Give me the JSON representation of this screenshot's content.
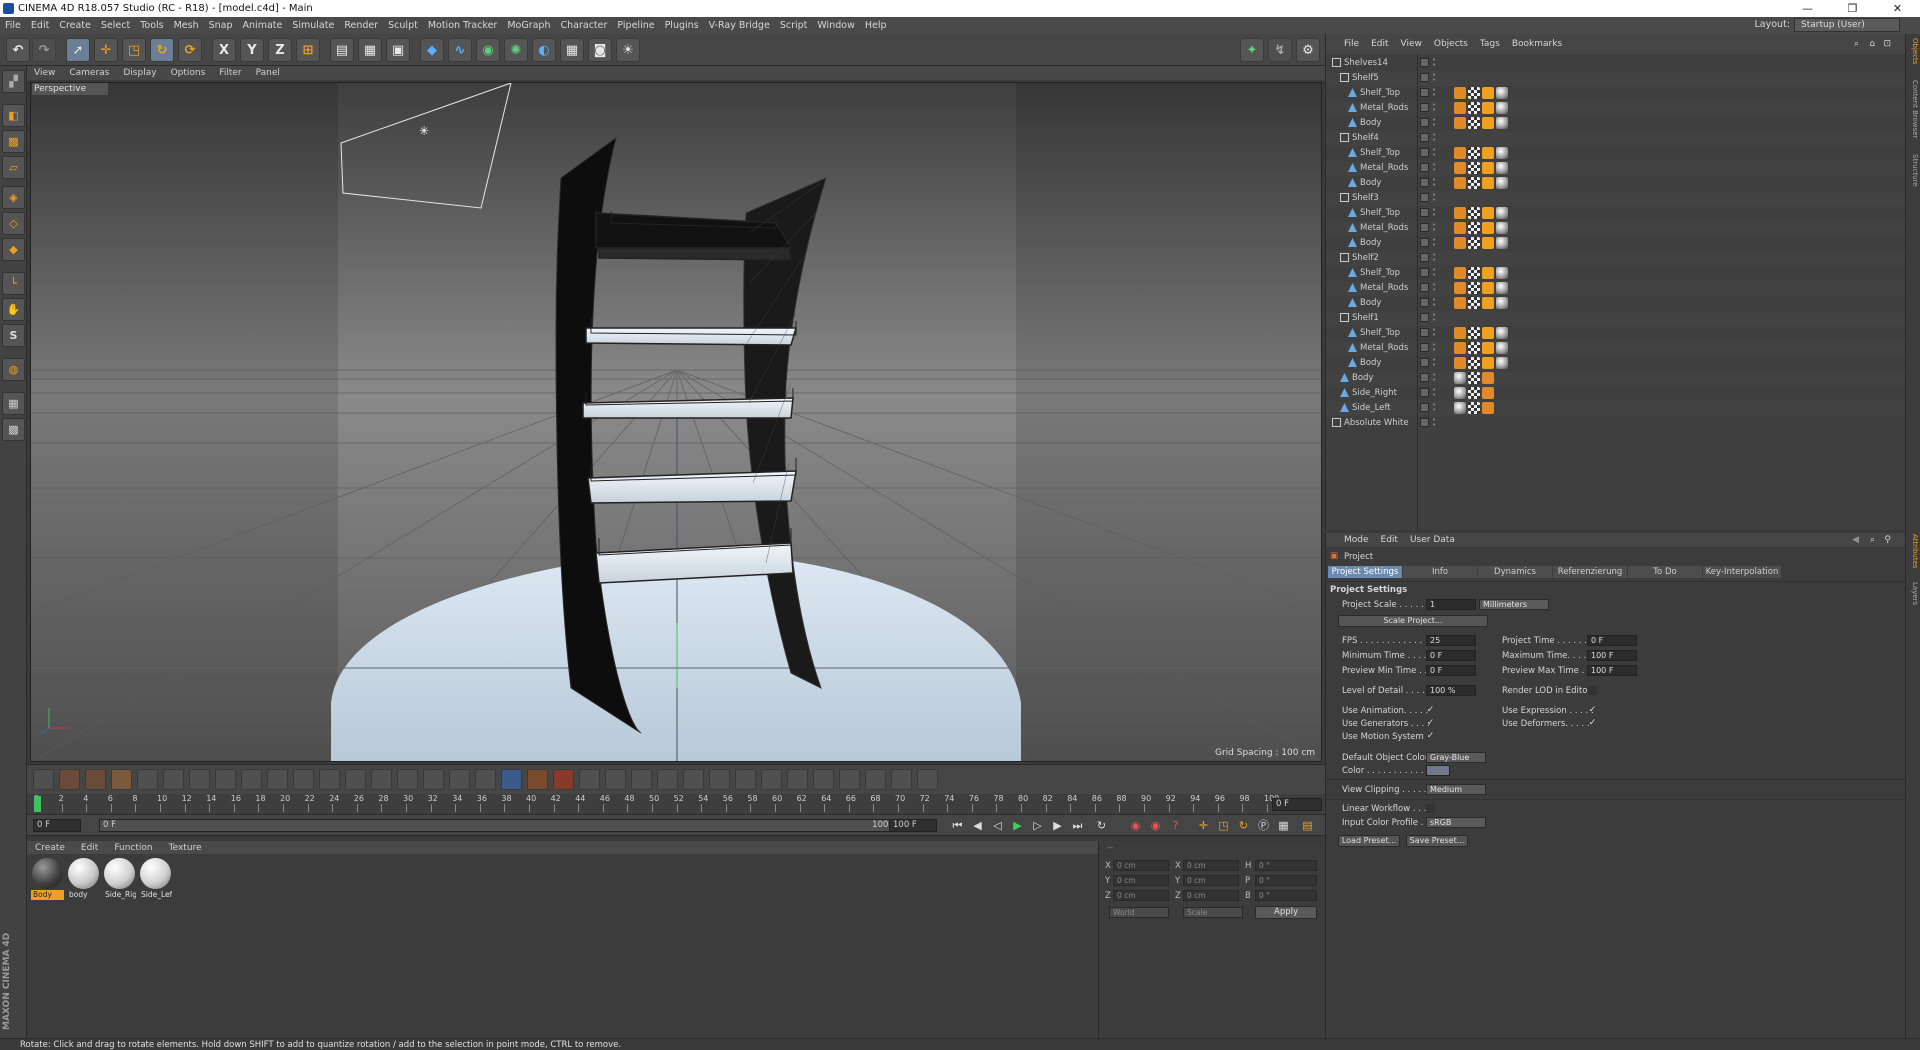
{
  "window": {
    "title": "CINEMA 4D R18.057 Studio (RC - R18) - [model.c4d] - Main",
    "controls": [
      "—",
      "❐",
      "✕"
    ]
  },
  "menubar": {
    "items": [
      "File",
      "Edit",
      "Create",
      "Select",
      "Tools",
      "Mesh",
      "Snap",
      "Animate",
      "Simulate",
      "Render",
      "Sculpt",
      "Motion Tracker",
      "MoGraph",
      "Character",
      "Pipeline",
      "Plugins",
      "V-Ray Bridge",
      "Script",
      "Window",
      "Help"
    ],
    "layout_label": "Layout:",
    "layout_value": "Startup (User)"
  },
  "toolbar": {
    "axis_x": "X",
    "axis_y": "Y",
    "axis_z": "Z"
  },
  "viewport": {
    "menu": [
      "View",
      "Cameras",
      "Display",
      "Options",
      "Filter",
      "Panel"
    ],
    "label": "Perspective",
    "grid_spacing": "Grid Spacing : 100 cm"
  },
  "timeline": {
    "ticks": [
      "0",
      "2",
      "4",
      "6",
      "8",
      "10",
      "12",
      "14",
      "16",
      "18",
      "20",
      "22",
      "24",
      "26",
      "28",
      "30",
      "32",
      "34",
      "36",
      "38",
      "40",
      "42",
      "44",
      "46",
      "48",
      "50",
      "52",
      "54",
      "56",
      "58",
      "60",
      "62",
      "64",
      "66",
      "68",
      "70",
      "72",
      "74",
      "76",
      "78",
      "80",
      "82",
      "84",
      "86",
      "88",
      "90",
      "92",
      "94",
      "96",
      "98",
      "100"
    ],
    "end_field": "0 F",
    "current": "0 F",
    "range_start": "0 F",
    "range_end": "100 F",
    "max": "100 F"
  },
  "material_manager": {
    "menu": [
      "Create",
      "Edit",
      "Function",
      "Texture"
    ],
    "materials": [
      {
        "name": "Body",
        "selected": true,
        "color": "#404040"
      },
      {
        "name": "body",
        "selected": false,
        "color": "#c9c9c9"
      },
      {
        "name": "Side_Rig",
        "selected": false,
        "color": "#d0d0d0"
      },
      {
        "name": "Side_Lef",
        "selected": false,
        "color": "#d0d0d0"
      }
    ]
  },
  "coordinates": {
    "header": "--",
    "rows": [
      {
        "a": "X",
        "av": "0 cm",
        "b": "X",
        "bv": "0 cm",
        "c": "H",
        "cv": "0 °"
      },
      {
        "a": "Y",
        "av": "0 cm",
        "b": "Y",
        "bv": "0 cm",
        "c": "P",
        "cv": "0 °"
      },
      {
        "a": "Z",
        "av": "0 cm",
        "b": "Z",
        "bv": "0 cm",
        "c": "B",
        "cv": "0 °"
      }
    ],
    "mode": "World",
    "scale_mode": "Scale",
    "apply": "Apply"
  },
  "logo": "MAXON CINEMA 4D",
  "status": "Rotate: Click and drag to rotate elements. Hold down SHIFT to add to quantize rotation / add to the selection in point mode, CTRL to remove.",
  "object_manager": {
    "menu": [
      "File",
      "Edit",
      "View",
      "Objects",
      "Tags",
      "Bookmarks"
    ],
    "rows": [
      {
        "name": "Shelves14",
        "indent": 0,
        "type": "null",
        "tags": 0
      },
      {
        "name": "Shelf5",
        "indent": 1,
        "type": "null",
        "tags": 0
      },
      {
        "name": "Shelf_Top",
        "indent": 2,
        "type": "poly",
        "tags": 4
      },
      {
        "name": "Metal_Rods",
        "indent": 2,
        "type": "poly",
        "tags": 4
      },
      {
        "name": "Body",
        "indent": 2,
        "type": "poly",
        "tags": 4
      },
      {
        "name": "Shelf4",
        "indent": 1,
        "type": "null",
        "tags": 0
      },
      {
        "name": "Shelf_Top",
        "indent": 2,
        "type": "poly",
        "tags": 4
      },
      {
        "name": "Metal_Rods",
        "indent": 2,
        "type": "poly",
        "tags": 4
      },
      {
        "name": "Body",
        "indent": 2,
        "type": "poly",
        "tags": 4
      },
      {
        "name": "Shelf3",
        "indent": 1,
        "type": "null",
        "tags": 0
      },
      {
        "name": "Shelf_Top",
        "indent": 2,
        "type": "poly",
        "tags": 4
      },
      {
        "name": "Metal_Rods",
        "indent": 2,
        "type": "poly",
        "tags": 4
      },
      {
        "name": "Body",
        "indent": 2,
        "type": "poly",
        "tags": 4
      },
      {
        "name": "Shelf2",
        "indent": 1,
        "type": "null",
        "tags": 0
      },
      {
        "name": "Shelf_Top",
        "indent": 2,
        "type": "poly",
        "tags": 4
      },
      {
        "name": "Metal_Rods",
        "indent": 2,
        "type": "poly",
        "tags": 4
      },
      {
        "name": "Body",
        "indent": 2,
        "type": "poly",
        "tags": 4
      },
      {
        "name": "Shelf1",
        "indent": 1,
        "type": "null",
        "tags": 0
      },
      {
        "name": "Shelf_Top",
        "indent": 2,
        "type": "poly",
        "tags": 4
      },
      {
        "name": "Metal_Rods",
        "indent": 2,
        "type": "poly",
        "tags": 4
      },
      {
        "name": "Body",
        "indent": 2,
        "type": "poly",
        "tags": 4
      },
      {
        "name": "Body",
        "indent": 1,
        "type": "poly",
        "tags": 3
      },
      {
        "name": "Side_Right",
        "indent": 1,
        "type": "poly",
        "tags": 3
      },
      {
        "name": "Side_Left",
        "indent": 1,
        "type": "poly",
        "tags": 3
      },
      {
        "name": "Absolute White",
        "indent": 0,
        "type": "null",
        "tags": 0
      }
    ]
  },
  "right_tabs": [
    "Objects",
    "Content Browser",
    "Structure",
    "Attributes",
    "Layers"
  ],
  "attribute_manager": {
    "menu": [
      "Mode",
      "Edit",
      "User Data"
    ],
    "object": "Project",
    "tabs": [
      "Project Settings",
      "Info",
      "Dynamics",
      "Referenzierung",
      "To Do",
      "Key-Interpolation"
    ],
    "section": "Project Settings",
    "project_scale_label": "Project Scale . . . . . .",
    "project_scale_value": "1",
    "project_scale_unit": "Millimeters",
    "scale_project": "Scale Project...",
    "fps_label": "FPS . . . . . . . . . . . . .",
    "fps": "25",
    "project_time_label": "Project Time . . . . . . .",
    "project_time": "0 F",
    "min_time_label": "Minimum Time . . . . .",
    "min_time": "0 F",
    "max_time_label": "Maximum Time. . . . . .",
    "max_time": "100 F",
    "prev_min_label": "Preview Min Time . .",
    "prev_min": "0 F",
    "prev_max_label": "Preview Max Time . .",
    "prev_max": "100 F",
    "lod_label": "Level of Detail . . . . .",
    "lod": "100 %",
    "render_lod_label": "Render LOD in Editor",
    "use_animation": "Use Animation. . . . .",
    "use_expression": "Use Expression . . . . .",
    "use_generators": "Use Generators . . . .",
    "use_deformers": "Use Deformers. . . . .",
    "use_motion": "Use Motion System",
    "default_color_label": "Default Object Color",
    "default_color": "Gray-Blue",
    "color_label": "Color . . . . . . . . . . . .",
    "view_clipping_label": "View Clipping . . . . .",
    "view_clipping": "Medium",
    "linear_workflow": "Linear Workflow . . . .",
    "input_color_label": "Input Color Profile . .",
    "input_color": "sRGB",
    "load_preset": "Load Preset...",
    "save_preset": "Save Preset..."
  }
}
